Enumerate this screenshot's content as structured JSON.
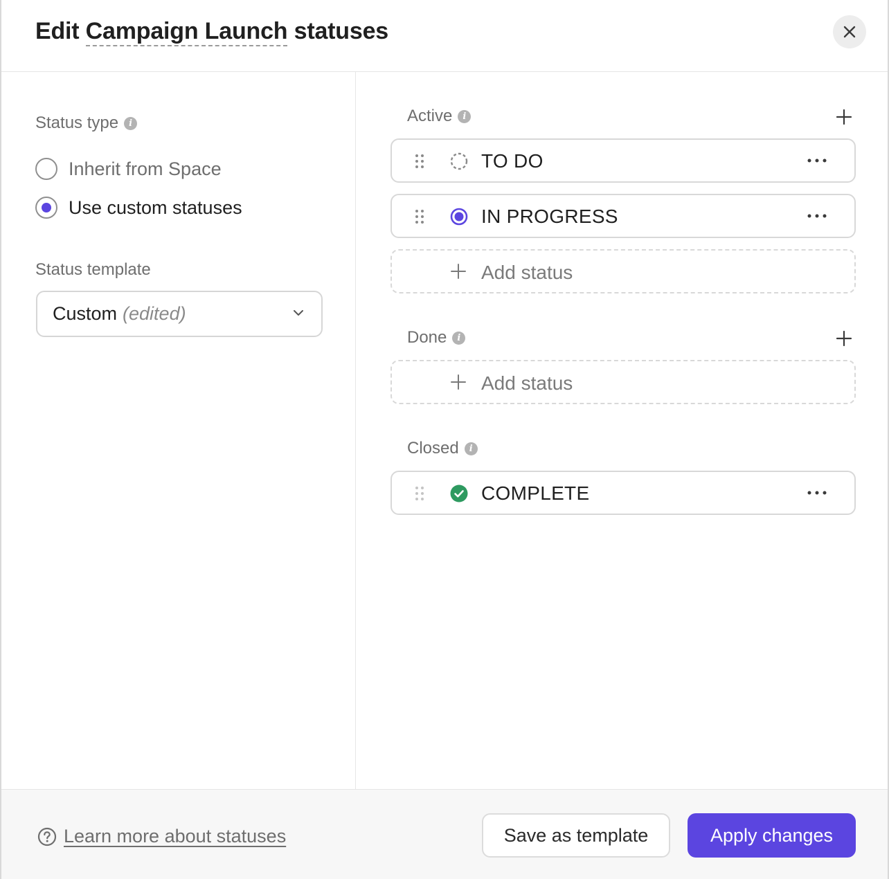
{
  "dialog": {
    "title_prefix": "Edit",
    "list_name": "Campaign Launch",
    "title_suffix": "statuses",
    "close_icon": "close-icon"
  },
  "left_panel": {
    "status_type_label": "Status type",
    "options": [
      {
        "label": "Inherit from Space",
        "selected": false
      },
      {
        "label": "Use custom statuses",
        "selected": true
      }
    ],
    "status_template_label": "Status template",
    "template_select": {
      "value": "Custom",
      "suffix": "(edited)"
    }
  },
  "groups": {
    "active": {
      "label": "Active",
      "statuses": [
        {
          "name": "TO DO",
          "icon": "dashed-circle-icon",
          "color": "#8a8a8a"
        },
        {
          "name": "IN PROGRESS",
          "icon": "in-progress-circle-icon",
          "color": "#5b45e0"
        }
      ],
      "add_label": "Add status"
    },
    "done": {
      "label": "Done",
      "add_label": "Add status"
    },
    "closed": {
      "label": "Closed",
      "statuses": [
        {
          "name": "COMPLETE",
          "icon": "check-circle-icon",
          "color": "#2e9a60"
        }
      ]
    }
  },
  "footer": {
    "help_link": "Learn more about statuses",
    "save_template": "Save as template",
    "apply": "Apply changes"
  },
  "colors": {
    "accent": "#5b45e0",
    "complete": "#2e9a60"
  }
}
